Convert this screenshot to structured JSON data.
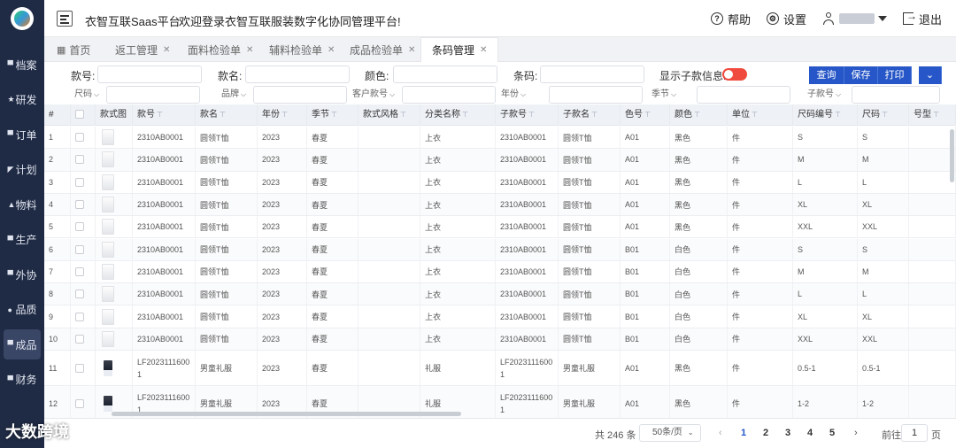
{
  "sidebar": {
    "items": [
      {
        "label": "档案",
        "icon": "folder-icon"
      },
      {
        "label": "研发",
        "icon": "star-icon"
      },
      {
        "label": "订单",
        "icon": "document-icon"
      },
      {
        "label": "计划",
        "icon": "send-icon"
      },
      {
        "label": "物料",
        "icon": "home-icon"
      },
      {
        "label": "生产",
        "icon": "factory-icon"
      },
      {
        "label": "外协",
        "icon": "chart-icon"
      },
      {
        "label": "品质",
        "icon": "check-icon"
      },
      {
        "label": "成品",
        "icon": "box-icon"
      },
      {
        "label": "财务",
        "icon": "wallet-icon"
      }
    ]
  },
  "header": {
    "brand": "衣智互联Saas平台",
    "welcome": "欢迎登录衣智互联服装数字化协同管理平台!",
    "help": "帮助",
    "settings": "设置",
    "logout": "退出"
  },
  "tabs": {
    "home": "首页",
    "items": [
      "返工管理",
      "面料检验单",
      "辅料检验单",
      "成品检验单",
      "条码管理"
    ]
  },
  "filters": {
    "style_no": "款号:",
    "style_name": "款名:",
    "color": "颜色:",
    "barcode": "条码:",
    "show_child": "显示子款信息:",
    "row2": [
      "尺码",
      "品牌",
      "客户款号",
      "年份",
      "季节",
      "子款号"
    ],
    "buttons": [
      "查询",
      "保存",
      "打印"
    ]
  },
  "table": {
    "columns": [
      "#",
      "",
      "款式图",
      "款号",
      "款名",
      "年份",
      "季节",
      "款式风格",
      "分类名称",
      "子款号",
      "子款名",
      "色号",
      "颜色",
      "单位",
      "尺码编号",
      "尺码",
      "号型"
    ],
    "rows": [
      {
        "n": "1",
        "img": "light",
        "style_no": "2310AB0001",
        "name": "圆领T恤",
        "year": "2023",
        "season": "春夏",
        "category": "上衣",
        "child_no": "2310AB0001",
        "child_name": "圆领T恤",
        "color_no": "A01",
        "color": "黑色",
        "unit": "件",
        "size_no": "S",
        "size": "S"
      },
      {
        "n": "2",
        "img": "light",
        "style_no": "2310AB0001",
        "name": "圆领T恤",
        "year": "2023",
        "season": "春夏",
        "category": "上衣",
        "child_no": "2310AB0001",
        "child_name": "圆领T恤",
        "color_no": "A01",
        "color": "黑色",
        "unit": "件",
        "size_no": "M",
        "size": "M"
      },
      {
        "n": "3",
        "img": "light",
        "style_no": "2310AB0001",
        "name": "圆领T恤",
        "year": "2023",
        "season": "春夏",
        "category": "上衣",
        "child_no": "2310AB0001",
        "child_name": "圆领T恤",
        "color_no": "A01",
        "color": "黑色",
        "unit": "件",
        "size_no": "L",
        "size": "L"
      },
      {
        "n": "4",
        "img": "light",
        "style_no": "2310AB0001",
        "name": "圆领T恤",
        "year": "2023",
        "season": "春夏",
        "category": "上衣",
        "child_no": "2310AB0001",
        "child_name": "圆领T恤",
        "color_no": "A01",
        "color": "黑色",
        "unit": "件",
        "size_no": "XL",
        "size": "XL"
      },
      {
        "n": "5",
        "img": "light",
        "style_no": "2310AB0001",
        "name": "圆领T恤",
        "year": "2023",
        "season": "春夏",
        "category": "上衣",
        "child_no": "2310AB0001",
        "child_name": "圆领T恤",
        "color_no": "A01",
        "color": "黑色",
        "unit": "件",
        "size_no": "XXL",
        "size": "XXL"
      },
      {
        "n": "6",
        "img": "light",
        "style_no": "2310AB0001",
        "name": "圆领T恤",
        "year": "2023",
        "season": "春夏",
        "category": "上衣",
        "child_no": "2310AB0001",
        "child_name": "圆领T恤",
        "color_no": "B01",
        "color": "白色",
        "unit": "件",
        "size_no": "S",
        "size": "S"
      },
      {
        "n": "7",
        "img": "light",
        "style_no": "2310AB0001",
        "name": "圆领T恤",
        "year": "2023",
        "season": "春夏",
        "category": "上衣",
        "child_no": "2310AB0001",
        "child_name": "圆领T恤",
        "color_no": "B01",
        "color": "白色",
        "unit": "件",
        "size_no": "M",
        "size": "M"
      },
      {
        "n": "8",
        "img": "light",
        "style_no": "2310AB0001",
        "name": "圆领T恤",
        "year": "2023",
        "season": "春夏",
        "category": "上衣",
        "child_no": "2310AB0001",
        "child_name": "圆领T恤",
        "color_no": "B01",
        "color": "白色",
        "unit": "件",
        "size_no": "L",
        "size": "L"
      },
      {
        "n": "9",
        "img": "light",
        "style_no": "2310AB0001",
        "name": "圆领T恤",
        "year": "2023",
        "season": "春夏",
        "category": "上衣",
        "child_no": "2310AB0001",
        "child_name": "圆领T恤",
        "color_no": "B01",
        "color": "白色",
        "unit": "件",
        "size_no": "XL",
        "size": "XL"
      },
      {
        "n": "10",
        "img": "light",
        "style_no": "2310AB0001",
        "name": "圆领T恤",
        "year": "2023",
        "season": "春夏",
        "category": "上衣",
        "child_no": "2310AB0001",
        "child_name": "圆领T恤",
        "color_no": "B01",
        "color": "白色",
        "unit": "件",
        "size_no": "XXL",
        "size": "XXL"
      },
      {
        "n": "11",
        "img": "dark",
        "style_no": "LF2023111600 1",
        "name": "男童礼服",
        "year": "2023",
        "season": "春夏",
        "category": "礼服",
        "child_no": "LF2023111600 1",
        "child_name": "男童礼服",
        "color_no": "A01",
        "color": "黑色",
        "unit": "件",
        "size_no": "0.5-1",
        "size": "0.5-1"
      },
      {
        "n": "12",
        "img": "dark",
        "style_no": "LF2023111600 1",
        "name": "男童礼服",
        "year": "2023",
        "season": "春夏",
        "category": "礼服",
        "child_no": "LF2023111600 1",
        "child_name": "男童礼服",
        "color_no": "A01",
        "color": "黑色",
        "unit": "件",
        "size_no": "1-2",
        "size": "1-2"
      }
    ]
  },
  "pagination": {
    "total": "共 246 条",
    "page_size": "50条/页",
    "pages": [
      "1",
      "2",
      "3",
      "4",
      "5"
    ],
    "goto": "前往",
    "current": "1",
    "page_unit": "页"
  },
  "watermark": "大数跨境"
}
